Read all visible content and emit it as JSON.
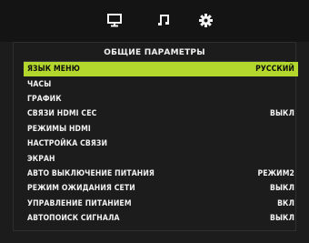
{
  "header": {
    "tabs": [
      {
        "icon": "monitor-icon"
      },
      {
        "icon": "music-note-icon"
      },
      {
        "icon": "gear-icon"
      }
    ]
  },
  "section": {
    "title": "ОБЩИЕ ПАРАМЕТРЫ"
  },
  "menu": {
    "items": [
      {
        "label": "ЯЗЫК МЕНЮ",
        "value": "РУССКИЙ",
        "selected": true
      },
      {
        "label": "ЧАСЫ",
        "value": ""
      },
      {
        "label": "ГРАФИК",
        "value": ""
      },
      {
        "label": "СВЯЗИ HDMI CEC",
        "value": "ВЫКЛ"
      },
      {
        "label": "РЕЖИМЫ HDMI",
        "value": ""
      },
      {
        "label": "НАСТРОЙКА СВЯЗИ",
        "value": ""
      },
      {
        "label": "ЭКРАН",
        "value": ""
      },
      {
        "label": "АВТО ВЫКЛЮЧЕНИЕ ПИТАНИЯ",
        "value": "РЕЖИМ2"
      },
      {
        "label": "РЕЖИМ ОЖИДАНИЯ СЕТИ",
        "value": "ВЫКЛ"
      },
      {
        "label": "УПРАВЛЕНИЕ ПИТАНИЕМ",
        "value": "ВКЛ"
      },
      {
        "label": "АВТОПОИСК СИГНАЛА",
        "value": "ВЫКЛ"
      }
    ]
  },
  "colors": {
    "highlight": "#b3d72c",
    "background": "#1c1c1c",
    "text": "#f2f2f2"
  }
}
